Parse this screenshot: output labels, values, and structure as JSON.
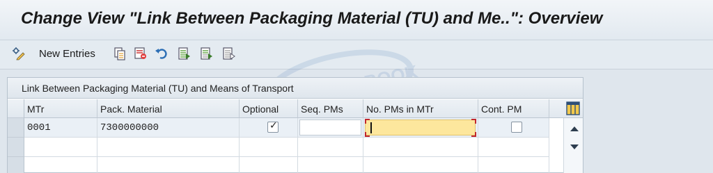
{
  "window": {
    "title": "Change View \"Link Between Packaging Material (TU) and Me..\": Overview"
  },
  "toolbar": {
    "new_entries_label": "New Entries",
    "icons": [
      "edit-toggle-icon",
      "copy-icon",
      "delete-icon",
      "undo-icon",
      "select-all-icon",
      "select-block-icon",
      "deselect-all-icon"
    ]
  },
  "panel": {
    "title": "Link Between Packaging Material (TU) and Means of Transport"
  },
  "table": {
    "columns": [
      "MTr",
      "Pack. Material",
      "Optional",
      "Seq. PMs",
      "No. PMs in MTr",
      "Cont. PM"
    ],
    "rows": [
      {
        "mtr": "0001",
        "pack_material": "7300000000",
        "optional": true,
        "seq_pms": "",
        "no_pms_in_mtr": "",
        "cont_pm": false
      }
    ]
  },
  "watermark": "LOAD BOOK"
}
